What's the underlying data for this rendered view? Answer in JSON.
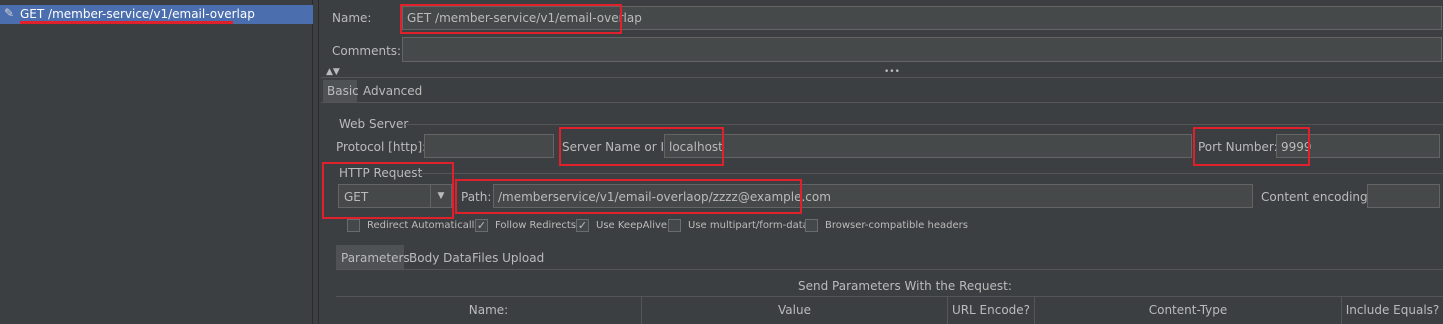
{
  "tree": {
    "item_label": "GET /member-service/v1/email-overlap",
    "item_icon": "pencil-icon"
  },
  "form": {
    "name_label": "Name:",
    "name_value": "GET /member-service/v1/email-overlap",
    "comments_label": "Comments:",
    "comments_value": "",
    "split_arrows": "▲▼",
    "split_dots": "•••"
  },
  "tabs": {
    "basic": "Basic",
    "advanced": "Advanced"
  },
  "web_server": {
    "title": "Web Server",
    "protocol_label": "Protocol [http]:",
    "protocol_value": "",
    "server_label": "Server Name or IP:",
    "server_value": "localhost",
    "port_label": "Port Number:",
    "port_value": "9999"
  },
  "http_request": {
    "title": "HTTP Request",
    "method_value": "GET",
    "path_label": "Path:",
    "path_value": "/memberservice/v1/email-overlaop/zzzz@example.com",
    "content_encoding_label": "Content encoding:",
    "content_encoding_value": ""
  },
  "options": [
    {
      "label": "Redirect Automatically",
      "checked": false
    },
    {
      "label": "Follow Redirects",
      "checked": true
    },
    {
      "label": "Use KeepAlive",
      "checked": true
    },
    {
      "label": "Use multipart/form-data",
      "checked": false
    },
    {
      "label": "Browser-compatible headers",
      "checked": false
    }
  ],
  "param_tabs": {
    "parameters": "Parameters",
    "body_data": "Body Data",
    "files_upload": "Files Upload"
  },
  "params_table": {
    "caption": "Send Parameters With the Request:",
    "columns": [
      "Name:",
      "Value",
      "URL Encode?",
      "Content-Type",
      "Include Equals?"
    ]
  },
  "colors": {
    "background": "#3c3f41",
    "selection": "#4b6eaf",
    "highlight_box": "#e0202a"
  }
}
